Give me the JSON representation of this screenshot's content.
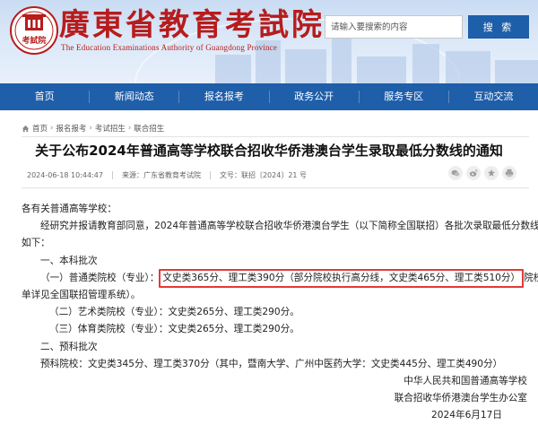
{
  "site": {
    "title": "廣東省教育考試院",
    "subtitle": "The Education Examinations Authority of Guangdong Province",
    "logo_text": "考試院"
  },
  "search": {
    "placeholder": "请输入要搜索的内容",
    "button_label": "搜 索"
  },
  "nav": {
    "items": [
      "首页",
      "新闻动态",
      "报名报考",
      "政务公开",
      "服务专区",
      "互动交流"
    ]
  },
  "breadcrumb": {
    "items": [
      "首页",
      "报名报考",
      "考试招生",
      "联合招生"
    ]
  },
  "article": {
    "title": "关于公布2024年普通高等学校联合招收华侨港澳台学生录取最低分数线的通知",
    "date": "2024-06-18 10:44:47",
    "source": "来源：广东省教育考试院",
    "doc_no": "文号：联招〔2024〕21 号",
    "paragraphs": {
      "salutation": "各有关普通高等学校：",
      "intro_1": "经研究并报请教育部同意，2024年普通高等学校联合招收华侨港澳台学生（以下简称全国联招）各批次录取最低分数线",
      "intro_2": "如下：",
      "section_1": "一、本科批次",
      "item_1_prefix": "（一）普通类院校（专业）：",
      "item_1_highlight": "文史类365分、理工类390分（部分院校执行高分线，文史类465分、理工类510分）",
      "item_1_suffix": "院校名",
      "item_1_cont": "单详见全国联招管理系统）。",
      "item_2": "（二）艺术类院校（专业）：文史类265分、理工类290分。",
      "item_3": "（三）体育类院校（专业）：文史类265分、理工类290分。",
      "section_2": "二、预科批次",
      "prep": "预科院校：文史类345分、理工类370分（其中，暨南大学、广州中医药大学：文史类445分、理工类490分）",
      "sign_1": "中华人民共和国普通高等学校",
      "sign_2": "联合招收华侨港澳台学生办公室",
      "sign_date": "2024年6月17日"
    }
  },
  "colors": {
    "brand_red": "#b71c1c",
    "nav_blue": "#1f5ea9",
    "highlight_red": "#e53935"
  }
}
